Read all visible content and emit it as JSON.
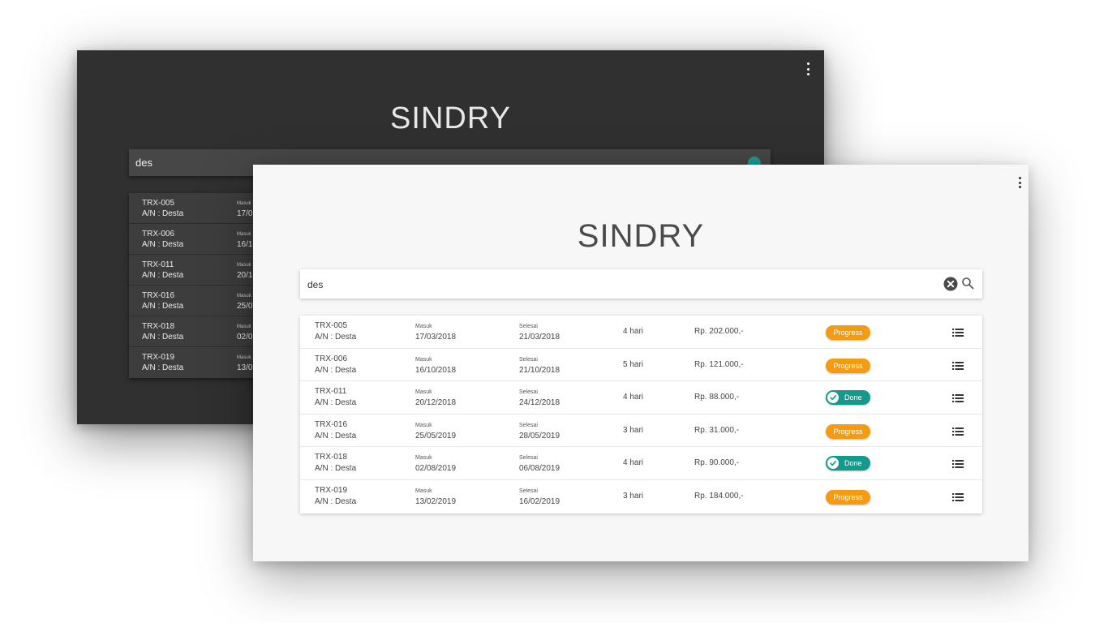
{
  "app": {
    "title": "SINDRY",
    "menu_icon": "more-vert-icon"
  },
  "search": {
    "value": "des",
    "clear_icon": "clear-circle-icon",
    "search_icon": "search-icon"
  },
  "labels": {
    "masuk": "Masuk",
    "selesai": "Selesai"
  },
  "colors": {
    "progress": "#f59b12",
    "done": "#16998b",
    "dark_bg": "#303030",
    "light_bg": "#f7f7f7"
  },
  "transactions": [
    {
      "code": "TRX-005",
      "owner": "A/N : Desta",
      "masuk": "17/03/2018",
      "selesai": "21/03/2018",
      "duration": "4 hari",
      "price": "Rp. 202.000,-",
      "status": "Progress"
    },
    {
      "code": "TRX-006",
      "owner": "A/N : Desta",
      "masuk": "16/10/2018",
      "selesai": "21/10/2018",
      "duration": "5 hari",
      "price": "Rp. 121.000,-",
      "status": "Progress"
    },
    {
      "code": "TRX-011",
      "owner": "A/N : Desta",
      "masuk": "20/12/2018",
      "selesai": "24/12/2018",
      "duration": "4 hari",
      "price": "Rp. 88.000,-",
      "status": "Done"
    },
    {
      "code": "TRX-016",
      "owner": "A/N : Desta",
      "masuk": "25/05/2019",
      "selesai": "28/05/2019",
      "duration": "3 hari",
      "price": "Rp. 31.000,-",
      "status": "Progress"
    },
    {
      "code": "TRX-018",
      "owner": "A/N : Desta",
      "masuk": "02/08/2019",
      "selesai": "06/08/2019",
      "duration": "4 hari",
      "price": "Rp. 90.000,-",
      "status": "Done"
    },
    {
      "code": "TRX-019",
      "owner": "A/N : Desta",
      "masuk": "13/02/2019",
      "selesai": "16/02/2019",
      "duration": "3 hari",
      "price": "Rp. 184.000,-",
      "status": "Progress"
    }
  ],
  "dark_preview": {
    "title": "SINDRY",
    "search_value": "des",
    "rows": [
      {
        "code": "TRX-005",
        "owner": "A/N : Desta",
        "label": "Masuk",
        "date": "17/0"
      },
      {
        "code": "TRX-006",
        "owner": "A/N : Desta",
        "label": "Masuk",
        "date": "16/1"
      },
      {
        "code": "TRX-011",
        "owner": "A/N : Desta",
        "label": "Masuk",
        "date": "20/1"
      },
      {
        "code": "TRX-016",
        "owner": "A/N : Desta",
        "label": "Masuk",
        "date": "25/0"
      },
      {
        "code": "TRX-018",
        "owner": "A/N : Desta",
        "label": "Masuk",
        "date": "02/0"
      },
      {
        "code": "TRX-019",
        "owner": "A/N : Desta",
        "label": "Masuk",
        "date": "13/0"
      }
    ]
  }
}
